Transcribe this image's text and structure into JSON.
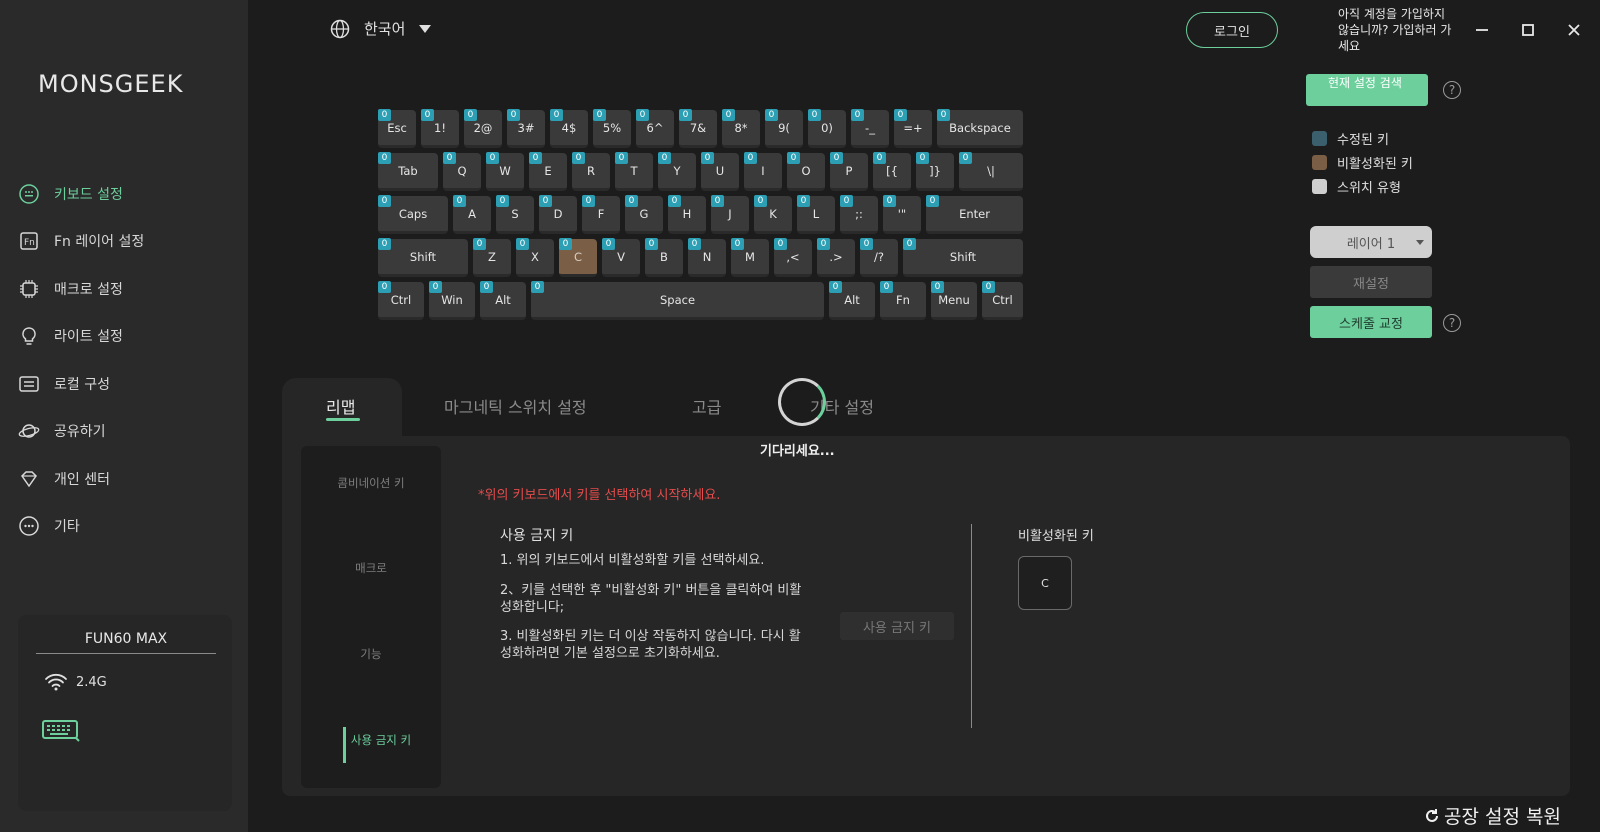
{
  "app": {
    "logo": "MONSGEEK"
  },
  "sidebar": {
    "items": [
      {
        "label": "키보드 설정",
        "icon": "keyboard-dots-icon",
        "active": true
      },
      {
        "label": "Fn 레이어 설정",
        "icon": "fn-icon",
        "active": false
      },
      {
        "label": "매크로 설정",
        "icon": "chip-icon",
        "active": false
      },
      {
        "label": "라이트 설정",
        "icon": "bulb-icon",
        "active": false
      },
      {
        "label": "로컬 구성",
        "icon": "local-config-icon",
        "active": false
      },
      {
        "label": "공유하기",
        "icon": "share-planet-icon",
        "active": false
      },
      {
        "label": "개인 센터",
        "icon": "diamond-icon",
        "active": false
      },
      {
        "label": "기타",
        "icon": "more-icon",
        "active": false
      }
    ],
    "device": {
      "name": "FUN60 MAX",
      "connection": "2.4G",
      "connection_icon": "wifi-icon",
      "device_icon": "keyboard-device-icon"
    }
  },
  "topbar": {
    "language": "한국어",
    "login": "로그인",
    "signup_prompt": "아직 계정을 가입하지 않습니까? 가입하러 가세요",
    "window": {
      "minimize": "—",
      "maximize": "□",
      "close": "✕"
    }
  },
  "right_panel": {
    "search_current": "현재 설정 검색",
    "help": "?",
    "legend": [
      {
        "label": "수정된 키",
        "color": "#3c5f6e"
      },
      {
        "label": "비활성화된 키",
        "color": "#7a5e45"
      },
      {
        "label": "스위치 유형",
        "color": "#cfcfcf"
      }
    ],
    "layer": "레이어 1",
    "reset": "재설정",
    "schedule": "스케줄 교정"
  },
  "keyboard": {
    "badge": "0",
    "rows": [
      [
        "Esc",
        "1!",
        "2@",
        "3#",
        "4$",
        "5%",
        "6^",
        "7&",
        "8*",
        "9(",
        "0)",
        "-_",
        "=+",
        "Backspace"
      ],
      [
        "Tab",
        "Q",
        "W",
        "E",
        "R",
        "T",
        "Y",
        "U",
        "I",
        "O",
        "P",
        "[{",
        "]}",
        "\\|"
      ],
      [
        "Caps",
        "A",
        "S",
        "D",
        "F",
        "G",
        "H",
        "J",
        "K",
        "L",
        ";:",
        "'\"",
        "Enter"
      ],
      [
        "Shift",
        "Z",
        "X",
        "C",
        "V",
        "B",
        "N",
        "M",
        ",<",
        ".>",
        "/?",
        "Shift"
      ],
      [
        "Ctrl",
        "Win",
        "Alt",
        "Space",
        "Alt",
        "Fn",
        "Menu",
        "Ctrl"
      ]
    ],
    "disabled_key": "C"
  },
  "tabs": [
    {
      "label": "리맵",
      "active": true
    },
    {
      "label": "마그네틱 스위치 설정",
      "active": false
    },
    {
      "label": "고급",
      "active": false
    },
    {
      "label": "기타 설정",
      "active": false
    }
  ],
  "remap": {
    "sub_items": [
      {
        "label": "콤비네이션 키",
        "active": false
      },
      {
        "label": "매크로",
        "active": false
      },
      {
        "label": "기능",
        "active": false
      },
      {
        "label": "사용 금지 키",
        "active": true
      }
    ],
    "loading": "기다리세요...",
    "hint": "*위의 키보드에서 키를 선택하여 시작하세요.",
    "disable_title": "사용 금지 키",
    "steps": [
      "1. 위의 키보드에서 비활성화할 키를 선택하세요.",
      "2、키를 선택한 후 \"비활성화 키\" 버튼을 클릭하여 비활성화합니다;",
      "3. 비활성화된 키는 더 이상 작동하지 않습니다. 다시 활성화하려면 기본 설정으로 초기화하세요."
    ],
    "disable_button": "사용 금지 키",
    "disabled_title": "비활성화된 키",
    "disabled_keys": [
      "C"
    ]
  },
  "footer": {
    "factory_reset": "공장 설정 복원"
  }
}
